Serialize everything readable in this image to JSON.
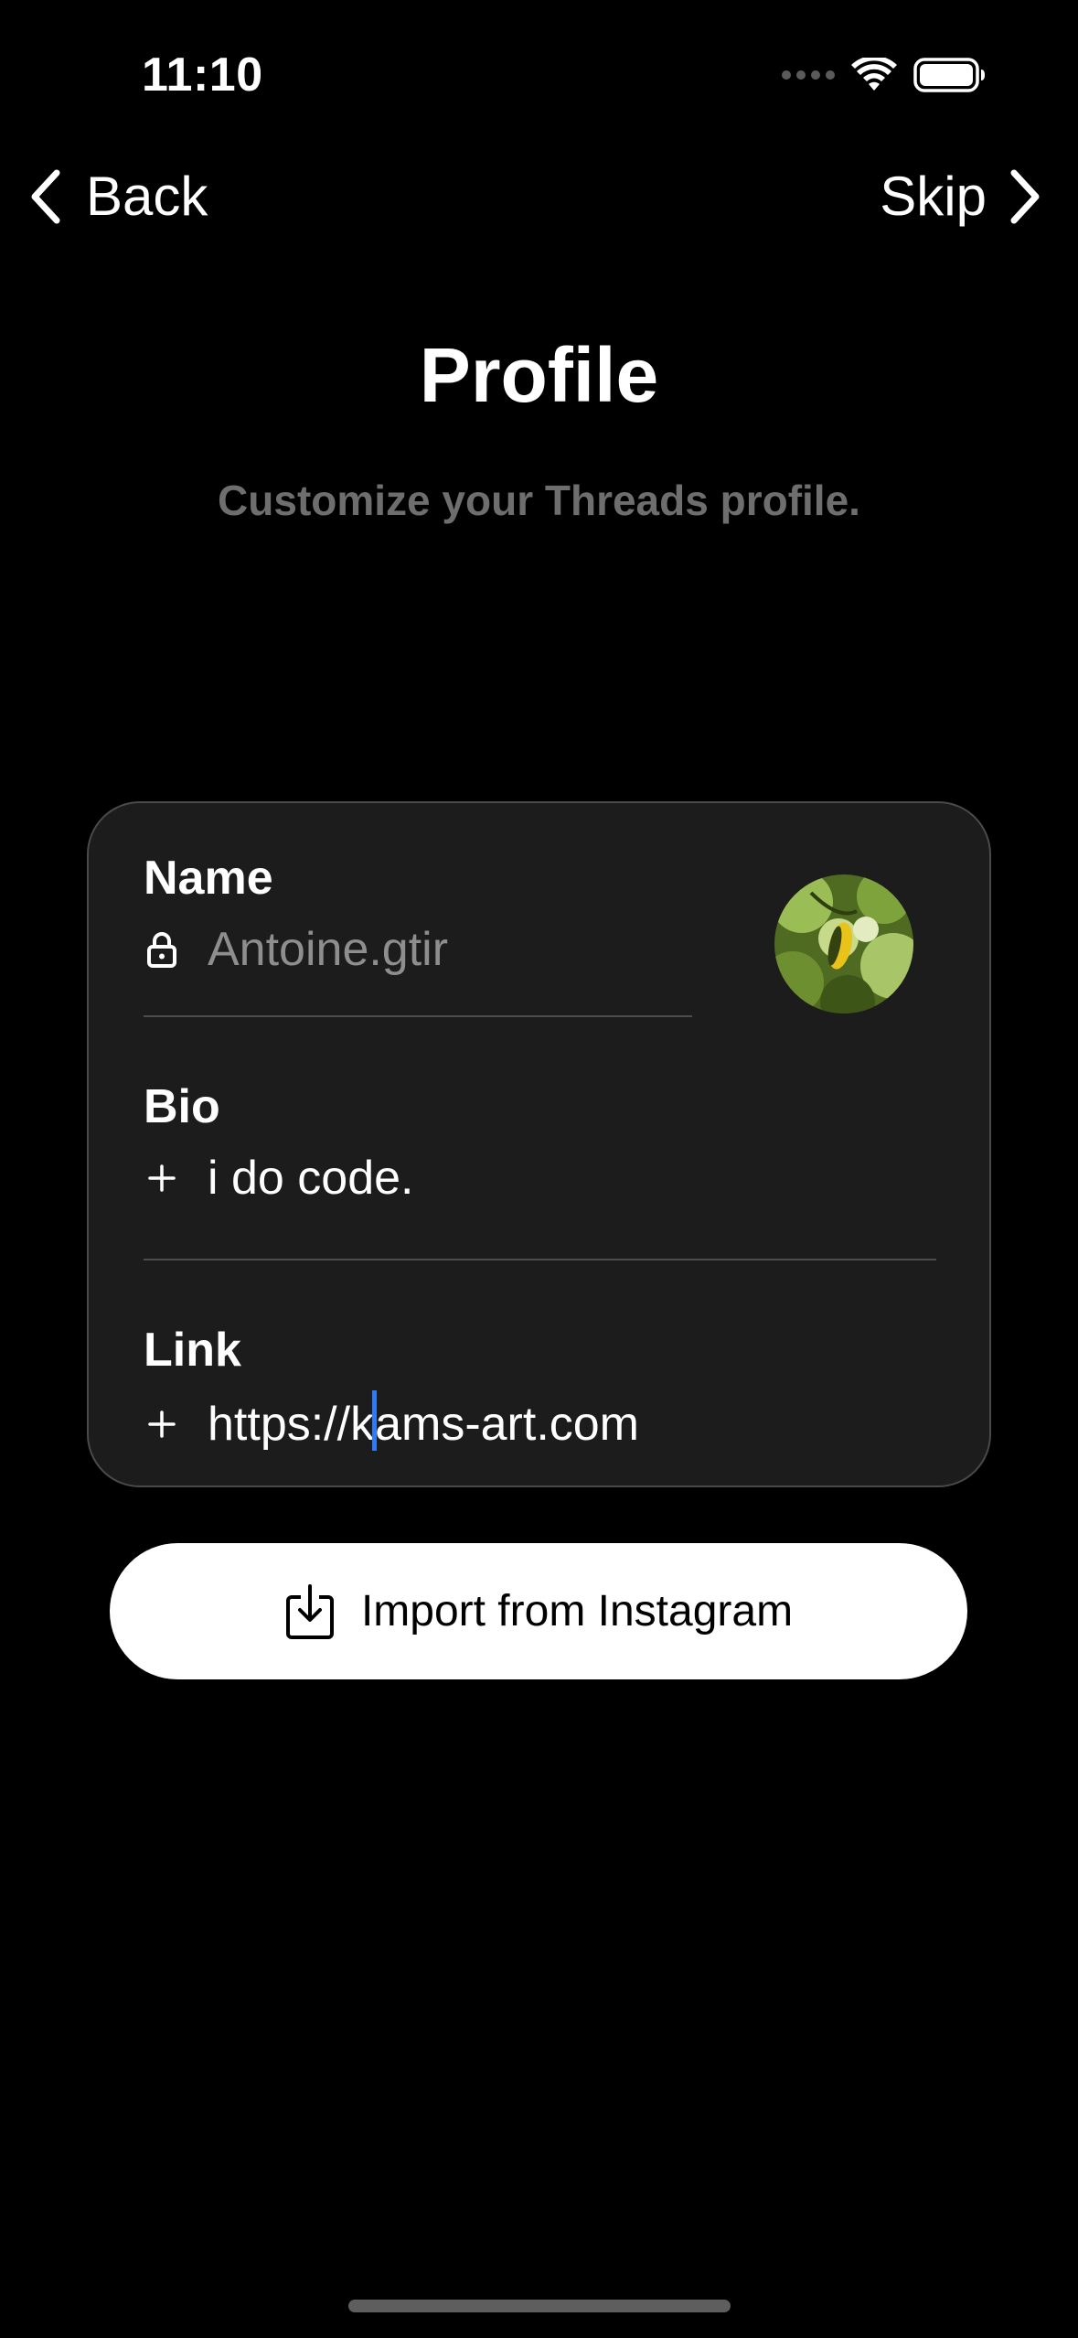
{
  "status_bar": {
    "time": "11:10",
    "wifi_icon": "wifi-icon",
    "battery_icon": "battery-icon"
  },
  "nav": {
    "back_label": "Back",
    "skip_label": "Skip"
  },
  "header": {
    "title": "Profile",
    "subtitle": "Customize your Threads profile."
  },
  "profile_card": {
    "name": {
      "label": "Name",
      "value": "Antoine.gtir",
      "icon": "lock-icon"
    },
    "bio": {
      "label": "Bio",
      "value": "i do code.",
      "icon": "plus-icon"
    },
    "link": {
      "label": "Link",
      "value_before_cursor": "https://k",
      "value_after_cursor": "ams-art.com",
      "icon": "plus-icon"
    }
  },
  "import_button": {
    "label": "Import from Instagram",
    "icon": "import-download-icon"
  },
  "colors": {
    "background": "#000000",
    "card": "#1c1c1c",
    "muted_text": "#6e6e6e",
    "cursor": "#2f7bf6"
  }
}
